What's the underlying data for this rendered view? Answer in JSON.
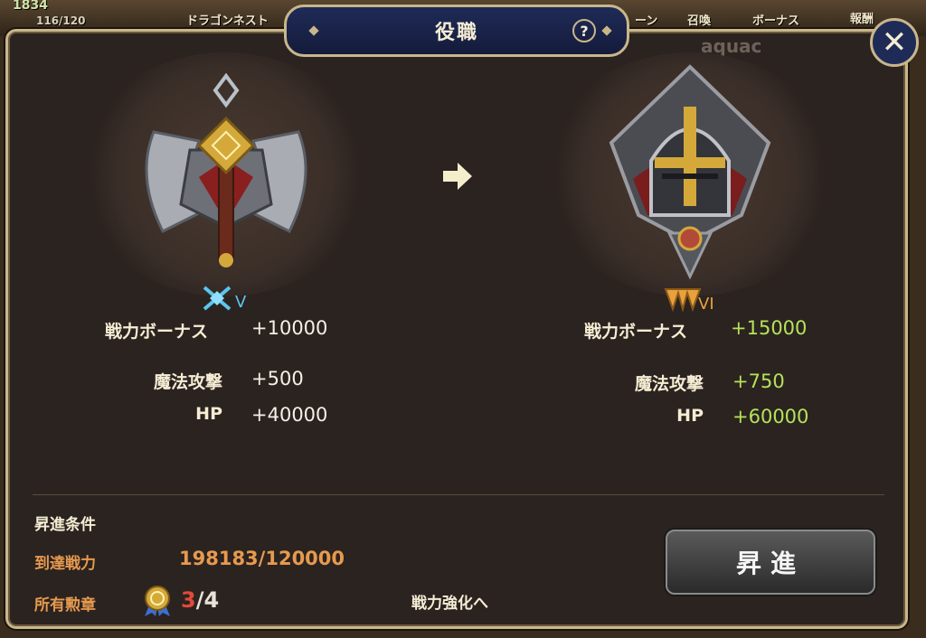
{
  "background": {
    "resource_count": "1834",
    "stamina": "116/120",
    "top_labels": [
      "ドラゴンネスト",
      "ーン",
      "召喚",
      "ボーナス",
      "報酬"
    ],
    "player_name": "aquac"
  },
  "dialog": {
    "title": "役職",
    "help_label": "?",
    "close_label": "✕"
  },
  "current_rank": {
    "emblem_icon": "axe-emblem-icon",
    "rank_numeral": "V",
    "stats": {
      "power_bonus_label": "戦力ボーナス",
      "power_bonus_value": "+10000",
      "magic_attack_label": "魔法攻撃",
      "magic_attack_value": "+500",
      "hp_label": "HP",
      "hp_value": "+40000"
    }
  },
  "next_rank": {
    "emblem_icon": "knight-helmet-emblem-icon",
    "rank_numeral": "VI",
    "stats": {
      "power_bonus_label": "戦力ボーナス",
      "power_bonus_value": "+15000",
      "magic_attack_label": "魔法攻撃",
      "magic_attack_value": "+750",
      "hp_label": "HP",
      "hp_value": "+60000"
    }
  },
  "conditions": {
    "title": "昇進条件",
    "power_label": "到達戦力",
    "power_value": "198183/120000",
    "medal_label": "所有勲章",
    "medal_have": "3",
    "medal_sep": "/",
    "medal_need": "4",
    "link_label": "戦力強化へ"
  },
  "promote_button": "昇進",
  "colors": {
    "accent_gold": "#c9b68a",
    "title_navy": "#1f2b57",
    "stat_green": "#b5e35a",
    "condition_orange": "#e69a4e",
    "medal_red": "#e04a3a"
  }
}
